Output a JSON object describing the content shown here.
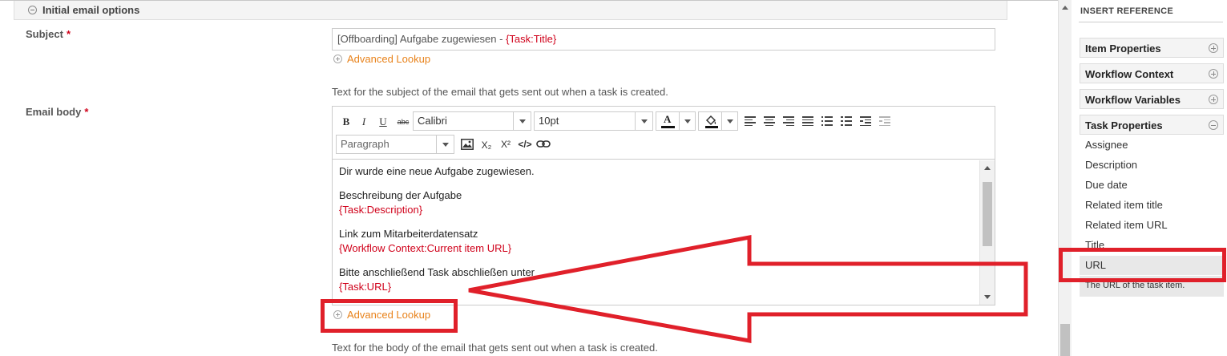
{
  "section": {
    "title": "Initial email options"
  },
  "subject": {
    "label": "Subject",
    "required_mark": "*",
    "value_text": "[Offboarding] Aufgabe zugewiesen - ",
    "value_token": "{Task:Title}",
    "lookup": "Advanced Lookup",
    "help": "Text for the subject of the email that gets sent out when a task is created."
  },
  "email_body": {
    "label": "Email body",
    "required_mark": "*",
    "toolbar": {
      "bold": "B",
      "italic": "I",
      "underline": "U",
      "strike": "abc",
      "font": "Calibri",
      "size": "10pt",
      "format": "Paragraph",
      "text_color_letter": "A",
      "subscript": "X₂",
      "superscript": "X²",
      "code": "</>"
    },
    "content": {
      "line1": "Dir wurde eine neue Aufgabe zugewiesen.",
      "line2": "Beschreibung der Aufgabe",
      "token2": "{Task:Description}",
      "line3": "Link zum Mitarbeiterdatensatz",
      "token3": "{Workflow Context:Current item URL}",
      "line4": "Bitte anschließend Task abschließen unter",
      "token4": "{Task:URL}"
    },
    "lookup": "Advanced Lookup",
    "help": "Text for the body of the email that gets sent out when a task is created."
  },
  "insert_reference": {
    "title": "INSERT REFERENCE",
    "sections": [
      {
        "label": "Item Properties",
        "state": "collapsed"
      },
      {
        "label": "Workflow Context",
        "state": "collapsed"
      },
      {
        "label": "Workflow Variables",
        "state": "collapsed"
      },
      {
        "label": "Task Properties",
        "state": "expanded"
      }
    ],
    "task_properties": [
      "Assignee",
      "Description",
      "Due date",
      "Related item title",
      "Related item URL",
      "Title",
      "URL"
    ],
    "selected": "URL",
    "selected_description": "The URL of the task item."
  },
  "colors": {
    "token": "#d0021b",
    "lookup": "#e8821a",
    "annotation": "#e0202a"
  }
}
